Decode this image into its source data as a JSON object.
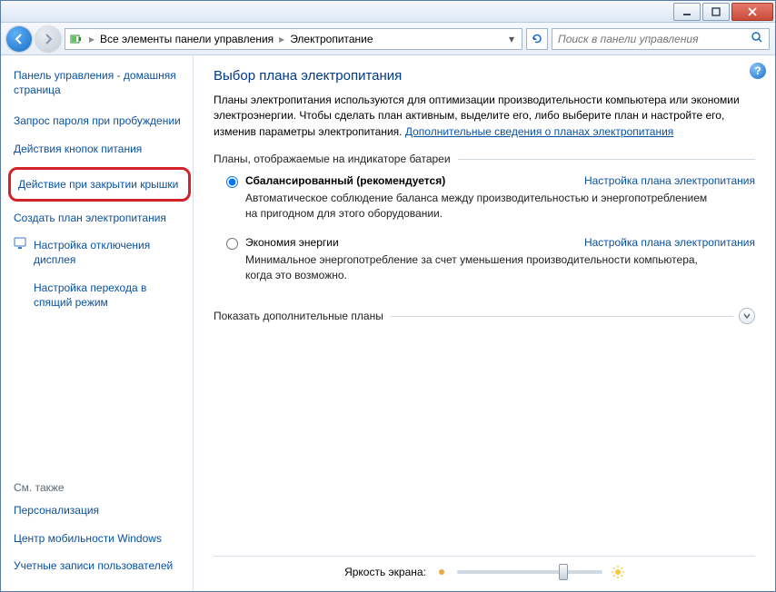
{
  "breadcrumb": {
    "item1": "Все элементы панели управления",
    "item2": "Электропитание"
  },
  "search": {
    "placeholder": "Поиск в панели управления"
  },
  "sidebar": {
    "home": "Панель управления - домашняя страница",
    "links": [
      "Запрос пароля при пробуждении",
      "Действия кнопок питания",
      "Действие при закрытии крышки",
      "Создать план электропитания",
      "Настройка отключения дисплея",
      "Настройка перехода в спящий режим"
    ],
    "see_also_hdr": "См. также",
    "see_also": [
      "Персонализация",
      "Центр мобильности Windows",
      "Учетные записи пользователей"
    ]
  },
  "content": {
    "title": "Выбор плана электропитания",
    "desc1": "Планы электропитания используются для оптимизации производительности компьютера или экономии электроэнергии. Чтобы сделать план активным, выделите его, либо выберите план и настройте его, изменив параметры электропитания. ",
    "desc_link": "Дополнительные сведения о планах электропитания",
    "group1": "Планы, отображаемые на индикаторе батареи",
    "group2": "Показать дополнительные планы",
    "plan_link": "Настройка плана электропитания",
    "plans": [
      {
        "name": "Сбалансированный (рекомендуется)",
        "desc": "Автоматическое соблюдение баланса между производительностью и энергопотреблением на пригодном для этого оборудовании."
      },
      {
        "name": "Экономия энергии",
        "desc": "Минимальное энергопотребление за счет уменьшения производительности компьютера, когда это возможно."
      }
    ],
    "brightness": "Яркость экрана:"
  }
}
